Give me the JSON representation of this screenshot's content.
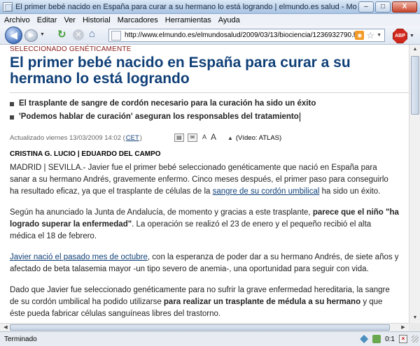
{
  "window": {
    "title": "El primer bebé nacido en España para curar a su hermano lo está logrando | elmundo.es salud - Mozilla Firefox",
    "minimize": "–",
    "maximize": "□",
    "close": "X"
  },
  "menu": [
    "Archivo",
    "Editar",
    "Ver",
    "Historial",
    "Marcadores",
    "Herramientas",
    "Ayuda"
  ],
  "toolbar": {
    "back": "◀",
    "forward": "▶",
    "reload": "C",
    "stop": "✕",
    "home": "⌂",
    "url": "http://www.elmundo.es/elmundosalud/2009/03/13/biociencia/1236932790.html",
    "abp": "ABP"
  },
  "article": {
    "kicker": "SELECCIONADO GENÉTICAMENTE",
    "headline": "El primer bebé nacido en España para curar a su hermano lo está logrando",
    "summary": [
      "El trasplante de sangre de cordón necesario para la curación ha sido un éxito",
      "'Podemos hablar de curación' aseguran los responsables del tratamiento"
    ],
    "updated_prefix": "Actualizado viernes 13/03/2009 14:02 (",
    "updated_tz": "CET",
    "updated_suffix": ")",
    "video_label": "(Vídeo: ATLAS)",
    "byline": "CRISTINA G. LUCIO | EDUARDO DEL CAMPO",
    "p1_a": "MADRID | SEVILLA.- Javier fue el primer bebé seleccionado genéticamente que nació en España para sanar a su hermano Andrés, gravemente enfermo. Cinco meses después, el primer paso para conseguirlo ha resultado eficaz, ya que el trasplante de células de la ",
    "p1_link": "sangre de su cordón umbilical",
    "p1_b": " ha sido un éxito.",
    "p2_a": "Según ha anunciado la Junta de Andalucía, de momento y gracias a este trasplante, ",
    "p2_bold": "parece que el niño \"ha logrado superar la enfermedad\"",
    "p2_b": ". La operación se realizó el 23 de enero y el pequeño recibió el alta médica el 18 de febrero.",
    "p3_link": "Javier nació el pasado mes de octubre",
    "p3_b": ", con la esperanza de poder dar a su hermano Andrés, de siete años y afectado de beta talasemia mayor -un tipo severo de anemia-, una oportunidad para seguir con vida.",
    "p4_a": "Dado que Javier fue seleccionado genéticamente para no sufrir la grave enfermedad hereditaria, la sangre de su cordón umbilical ha podido utilizarse ",
    "p4_bold": "para realizar un trasplante de médula a su hermano",
    "p4_b": " y que éste pueda fabricar células sanguíneas libres del trastorno."
  },
  "status": {
    "text": "Terminado",
    "time": "0:1"
  },
  "icons": {
    "back": "back-arrow-icon",
    "forward": "forward-arrow-icon",
    "reload": "reload-icon",
    "stop": "stop-icon",
    "home": "home-icon",
    "rss": "rss-feed-icon",
    "bookmark": "star-icon",
    "adblock": "adblock-plus-icon"
  },
  "colors": {
    "headline": "#0f3f77",
    "kicker": "#8a1c18",
    "link": "#0f3f77"
  }
}
